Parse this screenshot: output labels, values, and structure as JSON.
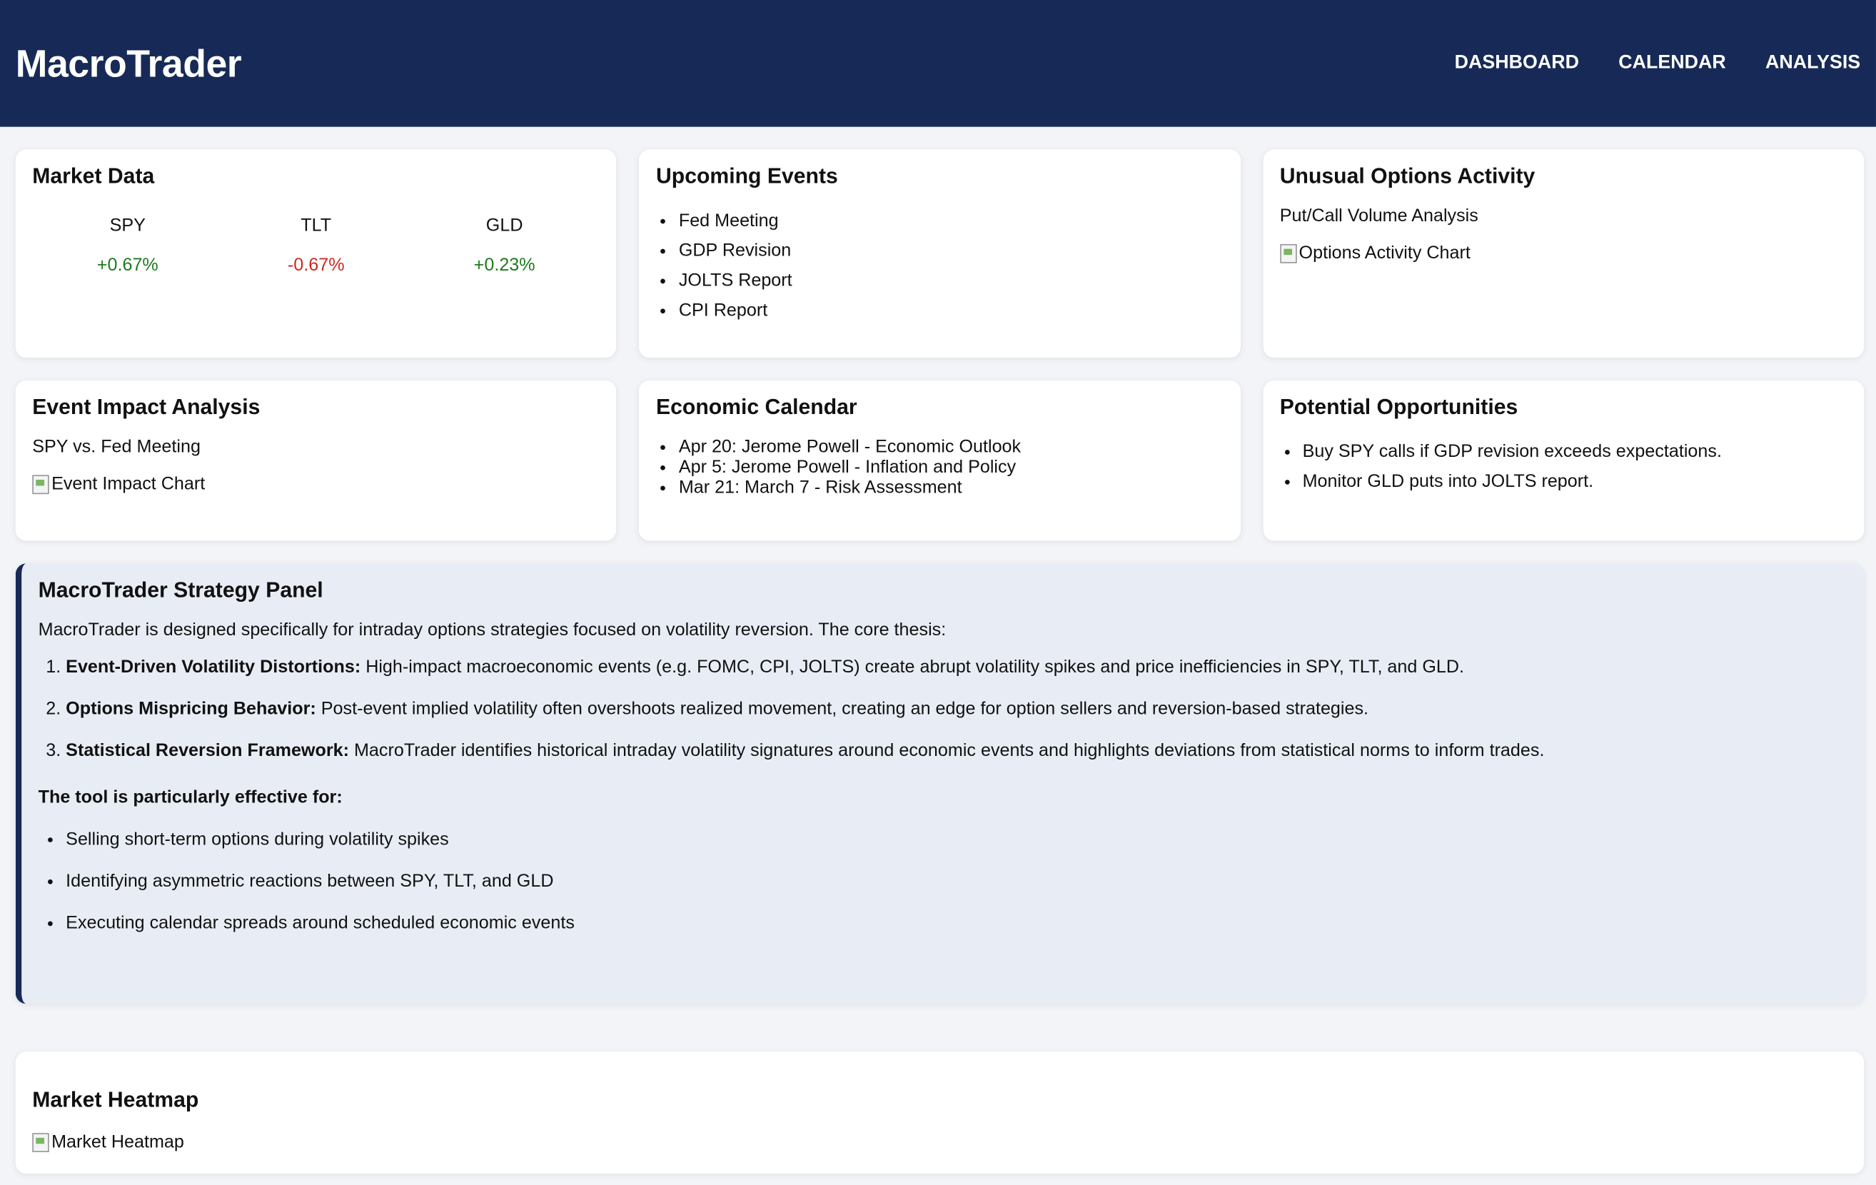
{
  "header": {
    "brand": "MacroTrader",
    "nav": [
      "DASHBOARD",
      "CALENDAR",
      "ANALYSIS"
    ]
  },
  "market_data": {
    "title": "Market Data",
    "tickers": [
      {
        "symbol": "SPY",
        "change": "+0.67%",
        "direction": "up"
      },
      {
        "symbol": "TLT",
        "change": "-0.67%",
        "direction": "down"
      },
      {
        "symbol": "GLD",
        "change": "+0.23%",
        "direction": "up"
      }
    ]
  },
  "upcoming_events": {
    "title": "Upcoming Events",
    "items": [
      "Fed Meeting",
      "GDP Revision",
      "JOLTS Report",
      "CPI Report"
    ]
  },
  "options_activity": {
    "title": "Unusual Options Activity",
    "subtitle": "Put/Call Volume Analysis",
    "image_alt": "Options Activity Chart"
  },
  "event_impact": {
    "title": "Event Impact Analysis",
    "subtitle": "SPY vs. Fed Meeting",
    "image_alt": "Event Impact Chart"
  },
  "economic_calendar": {
    "title": "Economic Calendar",
    "items": [
      "Apr 20: Jerome Powell - Economic Outlook",
      "Apr 5: Jerome Powell - Inflation and Policy",
      "Mar 21: March 7 - Risk Assessment"
    ]
  },
  "opportunities": {
    "title": "Potential Opportunities",
    "items": [
      "Buy SPY calls if GDP revision exceeds expectations.",
      "Monitor GLD puts into JOLTS report."
    ]
  },
  "strategy": {
    "title": "MacroTrader Strategy Panel",
    "intro": "MacroTrader is designed specifically for intraday options strategies focused on volatility reversion. The core thesis:",
    "points": [
      {
        "label": "Event-Driven Volatility Distortions:",
        "text": " High-impact macroeconomic events (e.g. FOMC, CPI, JOLTS) create abrupt volatility spikes and price inefficiencies in SPY, TLT, and GLD."
      },
      {
        "label": "Options Mispricing Behavior:",
        "text": " Post-event implied volatility often overshoots realized movement, creating an edge for option sellers and reversion-based strategies."
      },
      {
        "label": "Statistical Reversion Framework:",
        "text": " MacroTrader identifies historical intraday volatility signatures around economic events and highlights deviations from statistical norms to inform trades."
      }
    ],
    "effective_heading": "The tool is particularly effective for:",
    "uses": [
      "Selling short-term options during volatility spikes",
      "Identifying asymmetric reactions between SPY, TLT, and GLD",
      "Executing calendar spreads around scheduled economic events"
    ]
  },
  "heatmap": {
    "title": "Market Heatmap",
    "image_alt": "Market Heatmap"
  },
  "colors": {
    "header_bg": "#172a57",
    "up": "#1f7a1f",
    "down": "#d0281f",
    "panel_bg": "#e8edf5"
  }
}
